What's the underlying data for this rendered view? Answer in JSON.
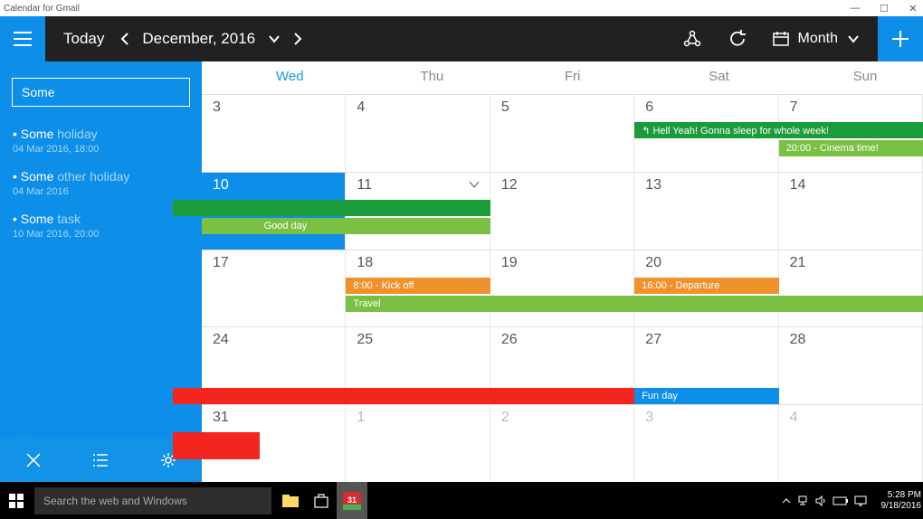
{
  "titlebar": {
    "title": "Calendar for Gmail"
  },
  "header": {
    "today": "Today",
    "month_label": "December, 2016",
    "view_label": "Month"
  },
  "sidebar": {
    "search": "Some",
    "items": [
      {
        "title_hl": "Some",
        "title_rest": " holiday",
        "sub": "04 Mar 2016, 18:00"
      },
      {
        "title_hl": "Some",
        "title_rest": " other holiday",
        "sub": "04 Mar 2016"
      },
      {
        "title_hl": "Some",
        "title_rest": " task",
        "sub": "10 Mar 2016, 20:00"
      }
    ]
  },
  "calendar": {
    "day_headers": [
      "Wed",
      "Thu",
      "Fri",
      "Sat",
      "Sun"
    ],
    "rows": [
      [
        "3",
        "4",
        "5",
        "6",
        "7"
      ],
      [
        "10",
        "11",
        "12",
        "13",
        "14"
      ],
      [
        "17",
        "18",
        "19",
        "20",
        "21"
      ],
      [
        "24",
        "25",
        "26",
        "27",
        "28"
      ],
      [
        "31",
        "1",
        "2",
        "3",
        "4"
      ]
    ],
    "events": {
      "sleep": "↰  Hell Yeah! Gonna sleep for whole week!",
      "cinema": "20:00 - Cinema time!",
      "goodday": "Good day",
      "kickoff": "8:00 - Kick off",
      "departure": "16:00 - Departure",
      "travel": "Travel",
      "funday": "Fun day"
    }
  },
  "taskbar": {
    "search_placeholder": "Search the web and Windows",
    "time": "5:28 PM",
    "date": "9/18/2016"
  },
  "colors": {
    "blue": "#0c8ee9",
    "green_dark": "#1b9c3b",
    "green": "#7ac143",
    "orange": "#f0922c",
    "red": "#f3261f"
  }
}
